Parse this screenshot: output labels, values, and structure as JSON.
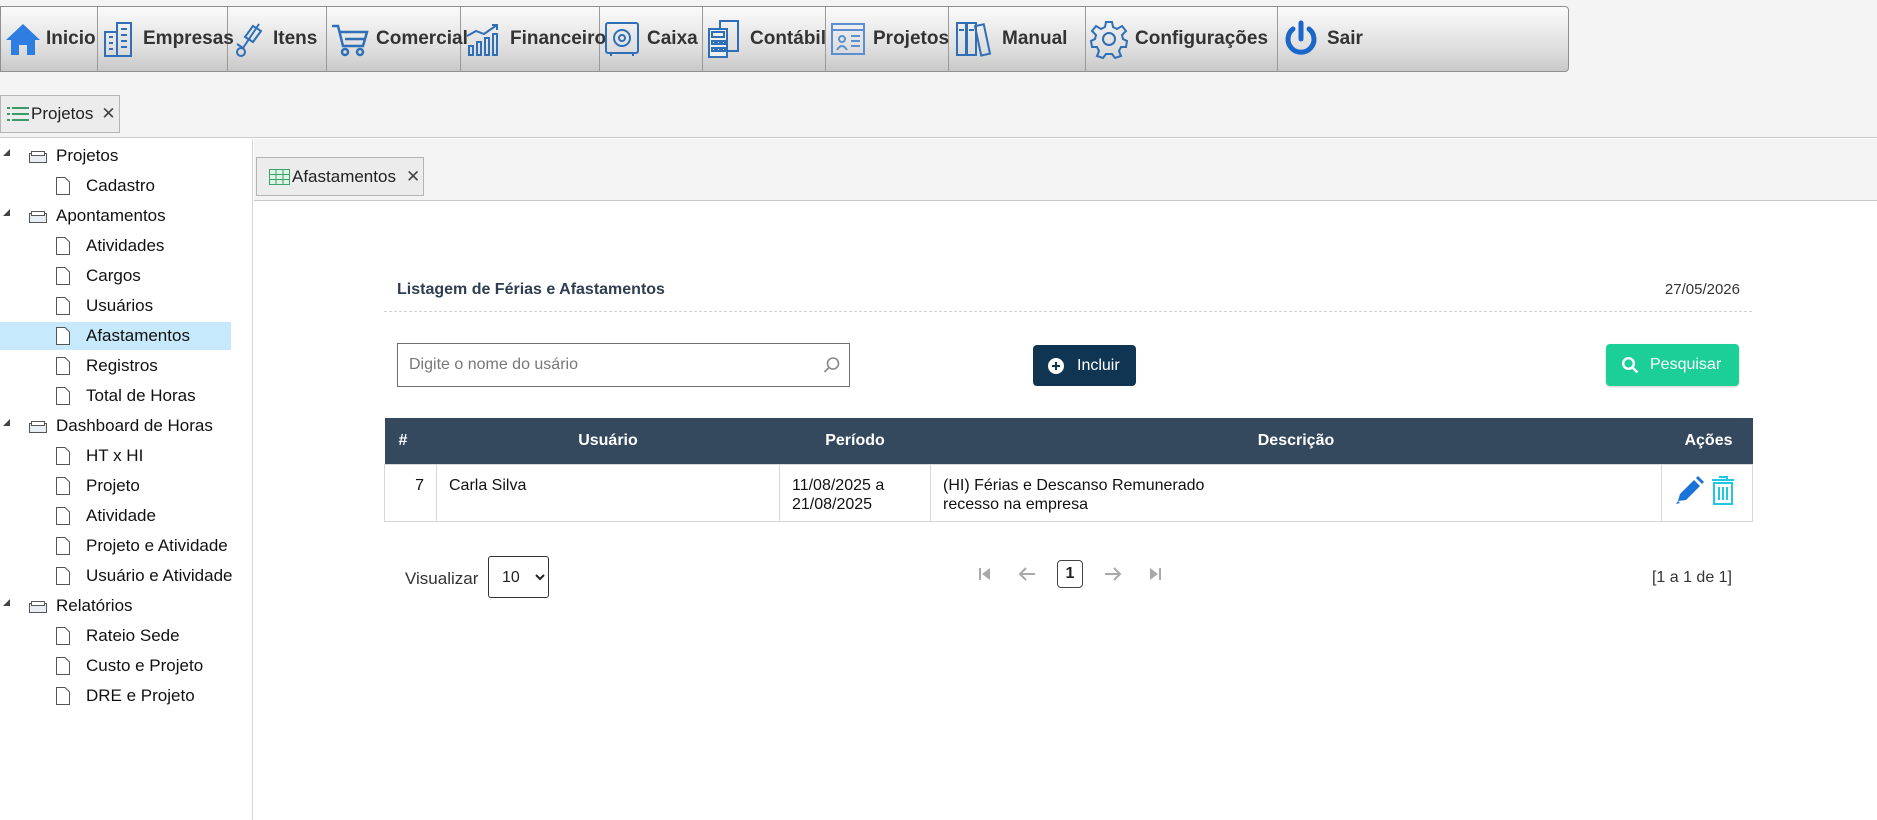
{
  "menu": {
    "items": [
      {
        "label": "Inicio",
        "icon": "home-icon"
      },
      {
        "label": "Empresas",
        "icon": "buildings-icon"
      },
      {
        "label": "Itens",
        "icon": "hand-truck-icon"
      },
      {
        "label": "Comercial",
        "icon": "shopping-cart-icon"
      },
      {
        "label": "Financeiro",
        "icon": "growth-chart-icon"
      },
      {
        "label": "Caixa",
        "icon": "safe-icon"
      },
      {
        "label": "Contábil",
        "icon": "calculator-icon"
      },
      {
        "label": "Projetos",
        "icon": "project-board-icon"
      },
      {
        "label": "Manual",
        "icon": "binders-icon"
      },
      {
        "label": "Configurações",
        "icon": "gear-icon"
      },
      {
        "label": "Sair",
        "icon": "power-icon"
      }
    ]
  },
  "module_tab": {
    "label": "Projetos",
    "close": "✕",
    "icon": "list-icon"
  },
  "content_tab": {
    "label": "Afastamentos",
    "close": "✕",
    "icon": "grid-icon"
  },
  "tree": {
    "groups": [
      {
        "label": "Projetos",
        "items": [
          "Cadastro"
        ]
      },
      {
        "label": "Apontamentos",
        "items": [
          "Atividades",
          "Cargos",
          "Usuários",
          "Afastamentos",
          "Registros",
          "Total de Horas"
        ]
      },
      {
        "label": "Dashboard de Horas",
        "items": [
          "HT x HI",
          "Projeto",
          "Atividade",
          "Projeto e Atividade",
          "Usuário e Atividade"
        ]
      },
      {
        "label": "Relatórios",
        "items": [
          "Rateio Sede",
          "Custo e Projeto",
          "DRE e Projeto"
        ]
      }
    ],
    "selected": "Afastamentos"
  },
  "panel": {
    "title": "Listagem de Férias e Afastamentos",
    "date": "27/05/2026",
    "search_placeholder": "Digite o nome do usário",
    "search_value": "",
    "include_label": "Incluir",
    "search_button_label": "Pesquisar"
  },
  "table": {
    "headers": [
      "#",
      "Usuário",
      "Período",
      "Descrição",
      "Ações"
    ],
    "rows": [
      {
        "id": "7",
        "user": "Carla Silva",
        "period_start": "11/08/2025 a",
        "period_end": "21/08/2025",
        "desc_line1": "(HI) Férias e Descanso Remunerado",
        "desc_line2": "recesso na empresa"
      }
    ]
  },
  "footer": {
    "view_label": "Visualizar",
    "page_size": "10",
    "page_size_options": [
      "10"
    ],
    "current_page": "1",
    "page_info": "[1 a 1 de 1]"
  },
  "colors": {
    "header_bg": "#34495e",
    "include_btn": "#0f3553",
    "search_btn": "#1ccf97",
    "selected_item": "#c6e9fb",
    "edit_icon": "#1a73d9",
    "delete_icon": "#1fc8e0"
  }
}
